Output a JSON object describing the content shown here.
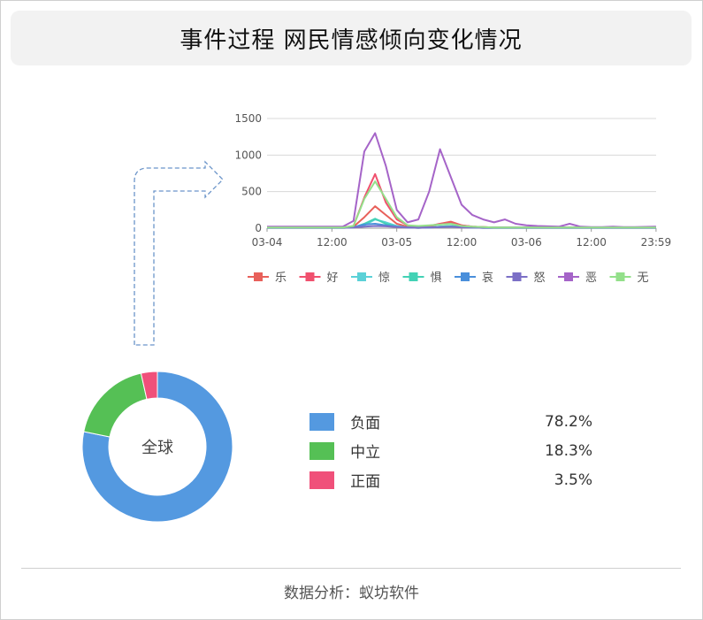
{
  "title": "事件过程 网民情感倾向变化情况",
  "footer": "数据分析：蚁坊软件",
  "chart_data": [
    {
      "type": "line",
      "x": [
        "03-04 00:00",
        "03-04 04:00",
        "03-04 08:00",
        "03-04 10:00",
        "03-04 12:00",
        "03-04 14:00",
        "03-04 16:00",
        "03-04 18:00",
        "03-04 20:00",
        "03-04 22:00",
        "03-05 00:00",
        "03-05 02:00",
        "03-05 04:00",
        "03-05 06:00",
        "03-05 08:00",
        "03-05 10:00",
        "03-05 12:00",
        "03-05 14:00",
        "03-05 16:00",
        "03-05 18:00",
        "03-05 20:00",
        "03-05 22:00",
        "03-06 00:00",
        "03-06 02:00",
        "03-06 04:00",
        "03-06 06:00",
        "03-06 08:00",
        "03-06 10:00",
        "03-06 12:00",
        "03-06 14:00",
        "03-06 16:00",
        "03-06 18:00",
        "03-06 20:00",
        "03-06 23:59"
      ],
      "x_ticks": [
        "03-04",
        "12:00",
        "03-05",
        "12:00",
        "03-06",
        "12:00",
        "23:59"
      ],
      "ylim": [
        0,
        1500
      ],
      "y_ticks": [
        0,
        500,
        1000,
        1500
      ],
      "grid": true,
      "legend_position": "bottom",
      "series": [
        {
          "name": "乐",
          "color": "#e8605a",
          "values": [
            10,
            10,
            10,
            10,
            10,
            10,
            20,
            150,
            300,
            180,
            60,
            20,
            15,
            20,
            60,
            90,
            40,
            20,
            15,
            10,
            10,
            10,
            10,
            10,
            10,
            10,
            10,
            10,
            10,
            10,
            10,
            10,
            10,
            10
          ]
        },
        {
          "name": "好",
          "color": "#f0506e",
          "values": [
            10,
            10,
            10,
            10,
            10,
            10,
            30,
            420,
            740,
            350,
            120,
            40,
            20,
            30,
            60,
            70,
            40,
            20,
            15,
            10,
            10,
            10,
            10,
            10,
            10,
            10,
            10,
            10,
            10,
            10,
            10,
            10,
            10,
            10
          ]
        },
        {
          "name": "惊",
          "color": "#5bd1d7",
          "values": [
            5,
            5,
            5,
            5,
            5,
            5,
            10,
            40,
            120,
            80,
            30,
            10,
            5,
            10,
            20,
            30,
            15,
            10,
            5,
            5,
            5,
            5,
            5,
            5,
            5,
            5,
            5,
            5,
            5,
            5,
            5,
            5,
            5,
            5
          ]
        },
        {
          "name": "惧",
          "color": "#43d2b5",
          "values": [
            5,
            5,
            5,
            5,
            5,
            5,
            10,
            60,
            130,
            60,
            20,
            10,
            5,
            10,
            20,
            30,
            15,
            10,
            5,
            5,
            5,
            5,
            5,
            5,
            5,
            5,
            5,
            5,
            5,
            5,
            5,
            5,
            5,
            5
          ]
        },
        {
          "name": "哀",
          "color": "#4a8fdb",
          "values": [
            10,
            10,
            10,
            10,
            10,
            10,
            15,
            50,
            60,
            40,
            20,
            10,
            10,
            10,
            15,
            20,
            15,
            10,
            10,
            10,
            10,
            10,
            10,
            10,
            10,
            10,
            10,
            10,
            10,
            10,
            10,
            10,
            10,
            10
          ]
        },
        {
          "name": "怒",
          "color": "#7b6fc6",
          "values": [
            5,
            5,
            5,
            5,
            5,
            5,
            10,
            20,
            30,
            25,
            15,
            10,
            5,
            10,
            15,
            20,
            10,
            10,
            5,
            5,
            5,
            5,
            5,
            5,
            5,
            5,
            5,
            5,
            5,
            5,
            5,
            5,
            5,
            5
          ]
        },
        {
          "name": "恶",
          "color": "#a564c8",
          "values": [
            20,
            20,
            20,
            20,
            20,
            20,
            100,
            1050,
            1300,
            850,
            250,
            80,
            120,
            500,
            1080,
            700,
            320,
            180,
            120,
            80,
            120,
            60,
            40,
            30,
            25,
            20,
            60,
            20,
            15,
            15,
            20,
            15,
            15,
            20
          ]
        },
        {
          "name": "无",
          "color": "#93e08a",
          "values": [
            10,
            10,
            10,
            10,
            10,
            10,
            30,
            400,
            640,
            400,
            150,
            40,
            30,
            40,
            50,
            60,
            30,
            20,
            15,
            10,
            10,
            10,
            10,
            10,
            10,
            10,
            10,
            10,
            10,
            10,
            10,
            10,
            10,
            10
          ]
        }
      ]
    },
    {
      "type": "pie",
      "center_label": "全球",
      "categories": [
        "负面",
        "中立",
        "正面"
      ],
      "values": [
        78.2,
        18.3,
        3.5
      ],
      "labels": [
        "78.2%",
        "18.3%",
        "3.5%"
      ],
      "colors": [
        "#5499e0",
        "#55c055",
        "#f0507a"
      ]
    }
  ]
}
